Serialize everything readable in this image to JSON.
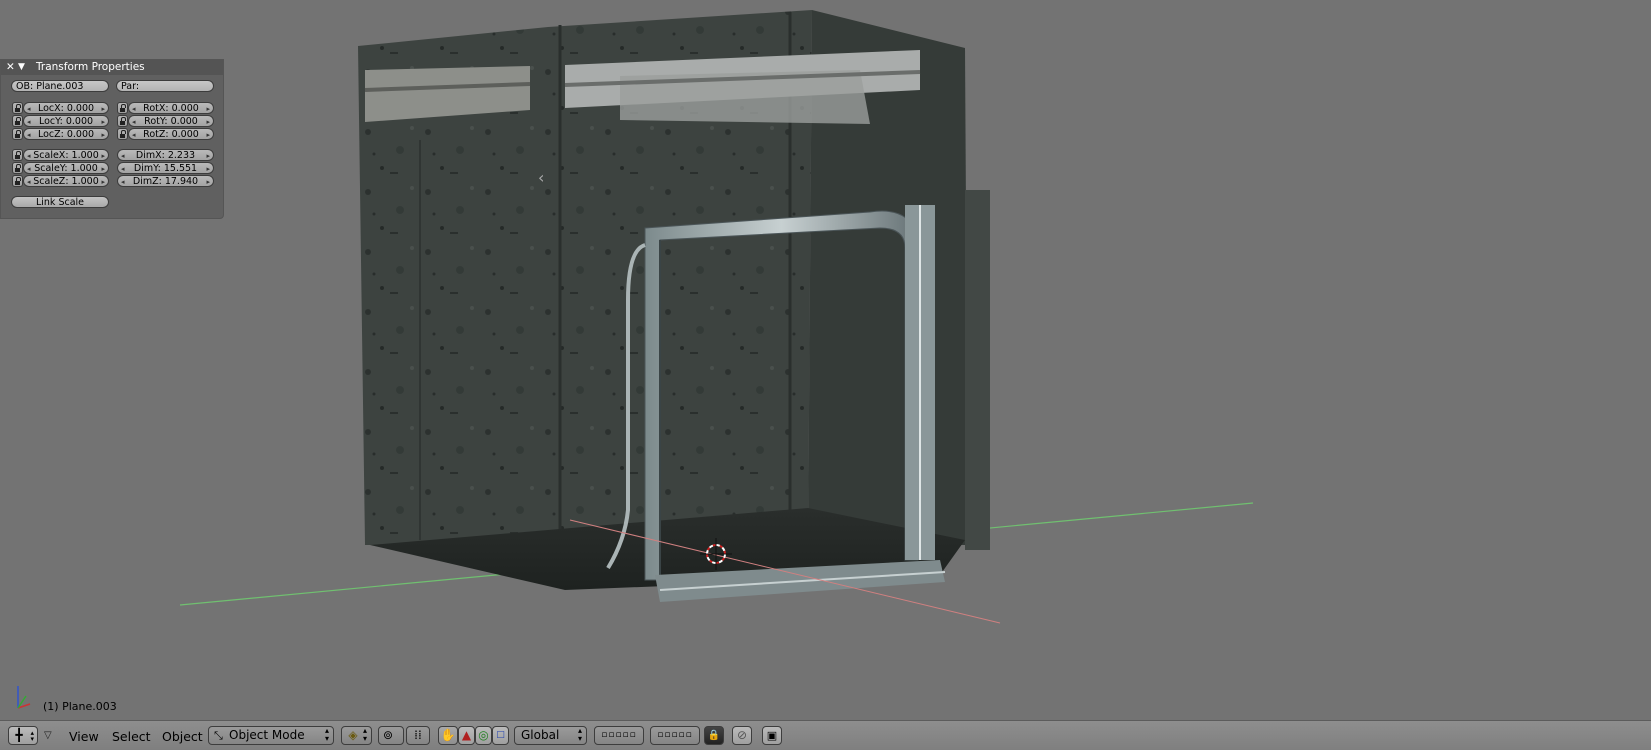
{
  "panel": {
    "title": "Transform Properties",
    "ob_field": "OB: Plane.003",
    "par_field": "Par:",
    "loc": [
      "LocX: 0.000",
      "LocY: 0.000",
      "LocZ: 0.000"
    ],
    "rot": [
      "RotX: 0.000",
      "RotY: 0.000",
      "RotZ: 0.000"
    ],
    "scale": [
      "ScaleX: 1.000",
      "ScaleY: 1.000",
      "ScaleZ: 1.000"
    ],
    "dim": [
      "DimX: 2.233",
      "DimY: 15.551",
      "DimZ: 17.940"
    ],
    "link_scale": "Link Scale"
  },
  "viewport": {
    "active_object_label": "(1) Plane.003"
  },
  "toolbar": {
    "menus": [
      "View",
      "Select",
      "Object"
    ],
    "mode": "Object Mode",
    "orientation": "Global"
  },
  "icons": {
    "close": "close-icon",
    "collapse": "triangle-down-icon",
    "lock": "lock-icon",
    "editor_type": "crosshair-icon",
    "draw_type": "shading-cube-icon",
    "pivot": "pivot-icon",
    "manipulator": "hand-icon",
    "translate": "translate-icon",
    "rotate": "rotate-icon",
    "scale": "scale-icon",
    "layers": "layer-grid-icon",
    "lock_layers": "lock-icon",
    "render": "render-icon",
    "image": "image-icon"
  },
  "colors": {
    "background": "#737373",
    "x_axis": "#d08080",
    "y_axis": "#70c070",
    "cursor": "#cc2222"
  }
}
